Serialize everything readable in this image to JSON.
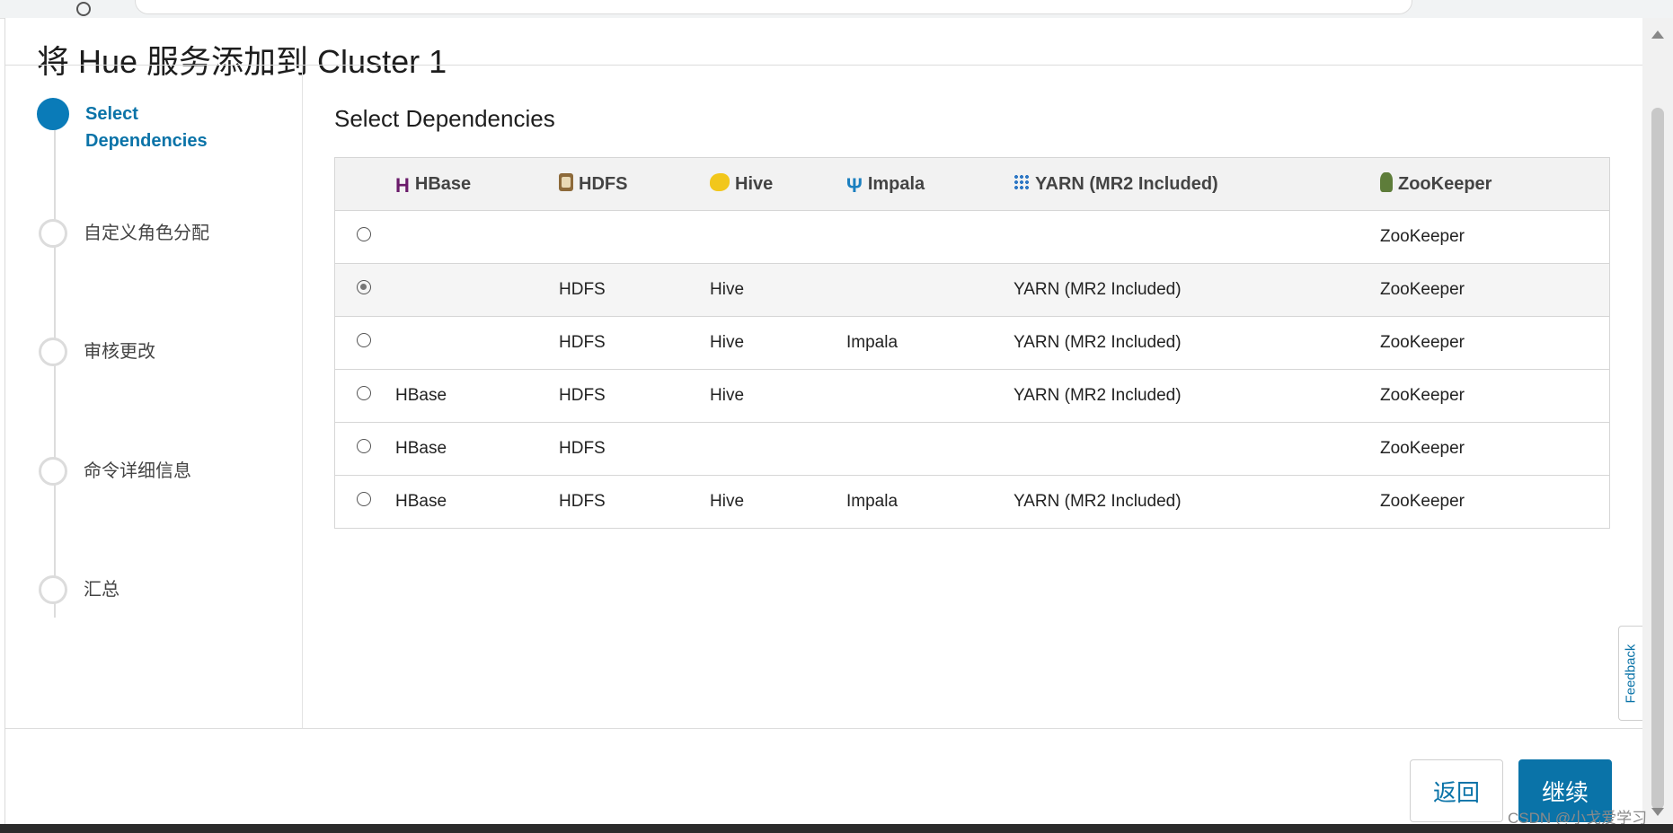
{
  "modal": {
    "title": "将 Hue 服务添加到 Cluster 1"
  },
  "steps": [
    {
      "label": "Select Dependencies",
      "active": true
    },
    {
      "label": "自定义角色分配",
      "active": false
    },
    {
      "label": "审核更改",
      "active": false
    },
    {
      "label": "命令详细信息",
      "active": false
    },
    {
      "label": "汇总",
      "active": false
    }
  ],
  "content": {
    "section_title": "Select Dependencies",
    "columns": [
      {
        "label": "HBase",
        "icon": "hbase-icon"
      },
      {
        "label": "HDFS",
        "icon": "hdfs-icon"
      },
      {
        "label": "Hive",
        "icon": "hive-icon"
      },
      {
        "label": "Impala",
        "icon": "impala-icon"
      },
      {
        "label": "YARN (MR2 Included)",
        "icon": "yarn-icon"
      },
      {
        "label": "ZooKeeper",
        "icon": "zookeeper-icon"
      }
    ],
    "rows": [
      {
        "selected": false,
        "cells": [
          "",
          "",
          "",
          "",
          "",
          "ZooKeeper"
        ]
      },
      {
        "selected": true,
        "cells": [
          "",
          "HDFS",
          "Hive",
          "",
          "YARN (MR2 Included)",
          "ZooKeeper"
        ]
      },
      {
        "selected": false,
        "cells": [
          "",
          "HDFS",
          "Hive",
          "Impala",
          "YARN (MR2 Included)",
          "ZooKeeper"
        ]
      },
      {
        "selected": false,
        "cells": [
          "HBase",
          "HDFS",
          "Hive",
          "",
          "YARN (MR2 Included)",
          "ZooKeeper"
        ]
      },
      {
        "selected": false,
        "cells": [
          "HBase",
          "HDFS",
          "",
          "",
          "",
          "ZooKeeper"
        ]
      },
      {
        "selected": false,
        "cells": [
          "HBase",
          "HDFS",
          "Hive",
          "Impala",
          "YARN (MR2 Included)",
          "ZooKeeper"
        ]
      }
    ]
  },
  "footer": {
    "back_label": "返回",
    "continue_label": "继续"
  },
  "feedback_label": "Feedback",
  "watermark": "CSDN @小戈爱学习",
  "colors": {
    "accent": "#0a73a8",
    "step_active": "#0a7bb8",
    "header_bg": "#f2f2f2"
  }
}
